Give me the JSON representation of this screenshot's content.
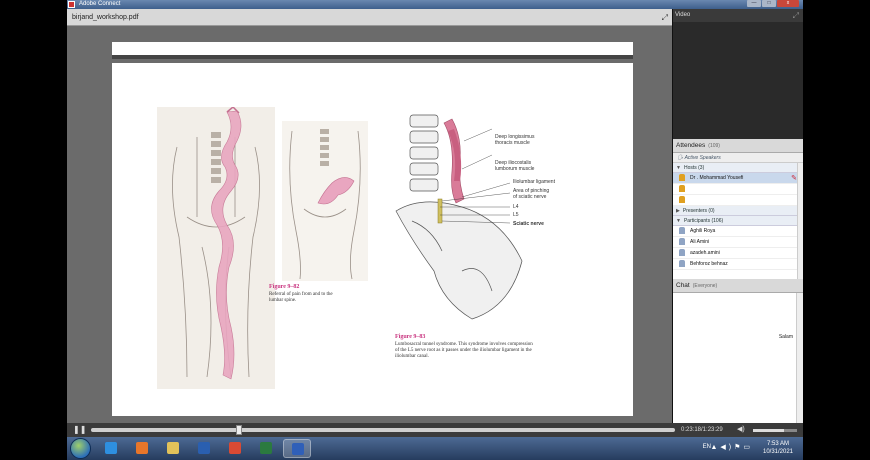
{
  "window": {
    "title": "Adobe Connect",
    "buttons": {
      "minimize": "—",
      "maximize": "□",
      "close": "x"
    }
  },
  "share_pod": {
    "file_name": "birjand_workshop.pdf",
    "fullscreen_icon": "expand-icon",
    "slide": {
      "labels": [
        "Deep longissimus",
        "thoracis muscle",
        "Deep iliocostalis",
        "lumborum muscle",
        "Iliolumbar ligament",
        "Area of pinching",
        "of sciatic nerve",
        "L4",
        "L5",
        "Sciatic nerve"
      ],
      "figure1": {
        "title": "Figure 9–82",
        "caption_line1": "Referral of pain from and to the",
        "caption_line2": "lumbar spine."
      },
      "figure2": {
        "title": "Figure 9–83",
        "caption_line1": "Lumbosacral tunnel syndrome. This syndrome involves compression",
        "caption_line2": "of the L5 nerve root as it passes under the iliolumbar ligament in the",
        "caption_line3": "iliolumbar canal."
      }
    }
  },
  "video_pod": {
    "title": "Video"
  },
  "attendees_pod": {
    "title": "Attendees",
    "count": "(109)",
    "active_speakers": "Active Speakers",
    "groups": {
      "hosts": "Hosts (3)",
      "presenters": "Presenters (0)",
      "participants": "Participants (106)"
    },
    "hosts": [
      {
        "name": "Dr . Mohammad Yousefi",
        "selected": true
      }
    ],
    "participants": [
      {
        "name": "Aghili Roya"
      },
      {
        "name": "Ali Amini"
      },
      {
        "name": "azadeh.amini"
      },
      {
        "name": "Behforoz behnaz"
      }
    ]
  },
  "chat_pod": {
    "title": "Chat",
    "scope": "(Everyone)",
    "messages": [
      "Salam"
    ]
  },
  "playback": {
    "position_fraction": 0.254,
    "time": "0:23:18/1:23:29",
    "volume_fraction": 0.7
  },
  "taskbar": {
    "lang": "EN",
    "clock_time": "7:53 AM",
    "clock_date": "10/31/2021",
    "apps": [
      {
        "name": "internet-explorer",
        "color": "#2e8fe0"
      },
      {
        "name": "firefox",
        "color": "#e8762a"
      },
      {
        "name": "file-explorer",
        "color": "#e2c25a"
      },
      {
        "name": "media-player",
        "color": "#2a5fb0"
      },
      {
        "name": "chrome",
        "color": "#d94a34"
      },
      {
        "name": "excel",
        "color": "#2b7a3f"
      },
      {
        "name": "word",
        "color": "#2f5fb8"
      }
    ],
    "active_app_index": 6
  }
}
